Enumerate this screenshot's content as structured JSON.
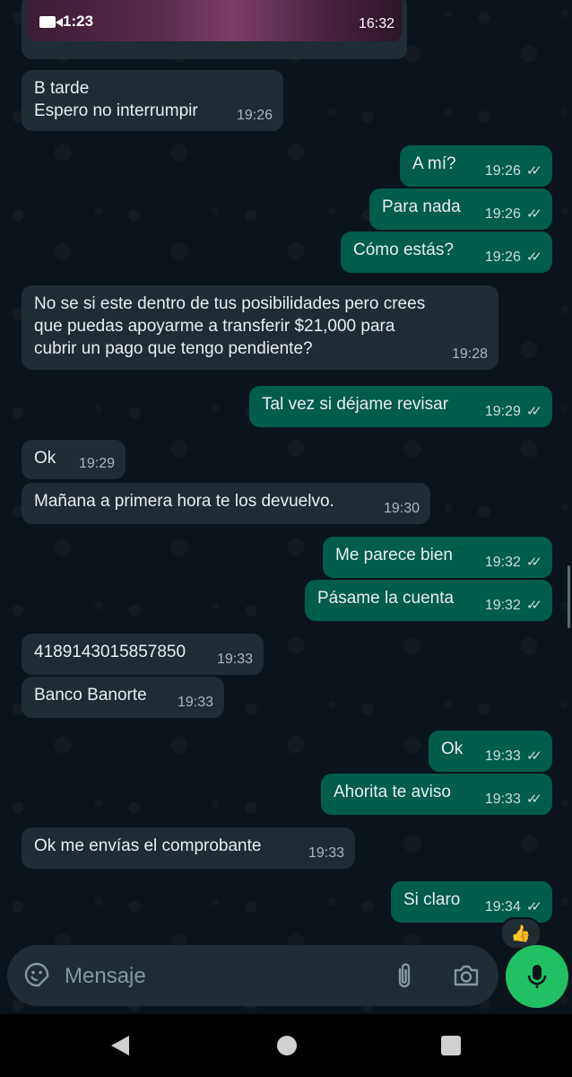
{
  "colors": {
    "incoming_bubble": "#1f2c34",
    "outgoing_bubble": "#005c4b",
    "chat_background": "#0b141a",
    "accent_green": "#21c063",
    "timestamp": "#aab7bf"
  },
  "media_message": {
    "type": "video",
    "duration": "1:23",
    "time": "16:32"
  },
  "messages": [
    {
      "dir": "in",
      "lines": [
        "B tarde",
        "Espero no interrumpir"
      ],
      "time": "19:26"
    },
    {
      "dir": "out",
      "lines": [
        "A mí?"
      ],
      "time": "19:26",
      "status": "read"
    },
    {
      "dir": "out",
      "lines": [
        "Para nada"
      ],
      "time": "19:26",
      "status": "read"
    },
    {
      "dir": "out",
      "lines": [
        "Cómo estás?"
      ],
      "time": "19:26",
      "status": "read"
    },
    {
      "dir": "in",
      "lines": [
        "No se si este dentro de tus posibilidades pero crees",
        "que puedas apoyarme a transferir $21,000 para",
        "cubrir un pago que tengo pendiente?"
      ],
      "time": "19:28"
    },
    {
      "dir": "out",
      "lines": [
        "Tal vez si déjame revisar"
      ],
      "time": "19:29",
      "status": "read"
    },
    {
      "dir": "in",
      "lines": [
        "Ok"
      ],
      "time": "19:29"
    },
    {
      "dir": "in",
      "lines": [
        "Mañana a primera hora te los devuelvo."
      ],
      "time": "19:30"
    },
    {
      "dir": "out",
      "lines": [
        "Me parece bien"
      ],
      "time": "19:32",
      "status": "read"
    },
    {
      "dir": "out",
      "lines": [
        "Pásame la cuenta"
      ],
      "time": "19:32",
      "status": "read"
    },
    {
      "dir": "in",
      "lines": [
        "4189143015857850"
      ],
      "time": "19:33"
    },
    {
      "dir": "in",
      "lines": [
        "Banco Banorte"
      ],
      "time": "19:33"
    },
    {
      "dir": "out",
      "lines": [
        "Ok"
      ],
      "time": "19:33",
      "status": "read"
    },
    {
      "dir": "out",
      "lines": [
        "Ahorita te aviso"
      ],
      "time": "19:33",
      "status": "read"
    },
    {
      "dir": "in",
      "lines": [
        "Ok me envías el comprobante"
      ],
      "time": "19:33"
    },
    {
      "dir": "out",
      "lines": [
        "Si claro"
      ],
      "time": "19:34",
      "status": "read",
      "reaction": "👍"
    }
  ],
  "input": {
    "placeholder": "Mensaje",
    "emoji_icon": "sticker-emoji-icon",
    "attach_icon": "paperclip-icon",
    "camera_icon": "camera-icon",
    "mic_icon": "microphone-icon"
  },
  "nav": {
    "back_icon": "triangle-back-icon",
    "home_icon": "circle-home-icon",
    "recents_icon": "square-recents-icon"
  }
}
